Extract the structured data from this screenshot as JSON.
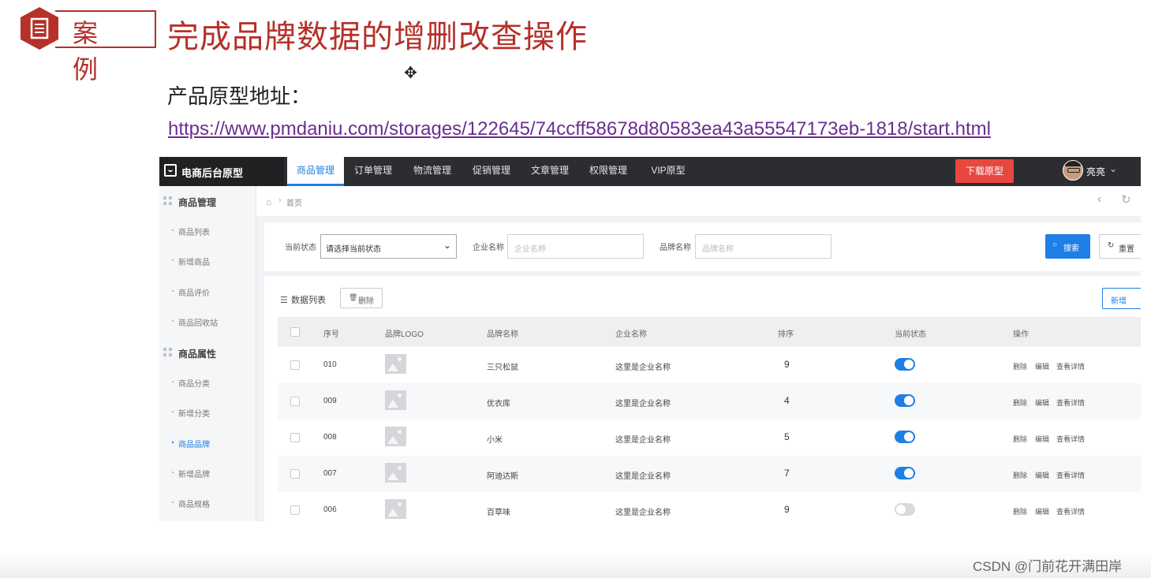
{
  "slide": {
    "badge": "案例",
    "title": "完成品牌数据的增删改查操作",
    "proto_label": "产品原型地址：",
    "proto_url": "https://www.pmdaniu.com/storages/122645/74ccff58678d80583ea43a55547173eb-1818/start.html"
  },
  "app": {
    "brand": "电商后台原型",
    "nav": [
      "商品管理",
      "订单管理",
      "物流管理",
      "促销管理",
      "文章管理",
      "权限管理",
      "VIP原型"
    ],
    "download_button": "下载原型",
    "user_name": "亮亮"
  },
  "sidebar": {
    "group1": "商品管理",
    "group1_items": [
      "商品列表",
      "新增商品",
      "商品评价",
      "商品回收站"
    ],
    "group2": "商品属性",
    "group2_items": [
      "商品分类",
      "新增分类",
      "商品品牌",
      "新增品牌",
      "商品规格"
    ],
    "active_item": "商品品牌"
  },
  "breadcrumb": {
    "current": "首页"
  },
  "filter": {
    "status_label": "当前状态",
    "status_value": "请选择当前状态",
    "company_label": "企业名称",
    "company_placeholder": "企业名称",
    "brand_label": "品牌名称",
    "brand_placeholder": "品牌名称",
    "search_button": "搜索",
    "reset_button": "重置"
  },
  "list": {
    "title": "数据列表",
    "delete_button": "删除",
    "add_button": "新增",
    "columns": [
      "序号",
      "品牌LOGO",
      "品牌名称",
      "企业名称",
      "排序",
      "当前状态",
      "操作"
    ],
    "actions": [
      "删除",
      "编辑",
      "查看详情"
    ],
    "rows": [
      {
        "id": "010",
        "brand": "三只松鼠",
        "company": "这里是企业名称",
        "order": "9",
        "enabled": true
      },
      {
        "id": "009",
        "brand": "优衣库",
        "company": "这里是企业名称",
        "order": "4",
        "enabled": true
      },
      {
        "id": "008",
        "brand": "小米",
        "company": "这里是企业名称",
        "order": "5",
        "enabled": true
      },
      {
        "id": "007",
        "brand": "阿迪达斯",
        "company": "这里是企业名称",
        "order": "7",
        "enabled": true
      },
      {
        "id": "006",
        "brand": "百草味",
        "company": "这里是企业名称",
        "order": "9",
        "enabled": false
      }
    ]
  },
  "watermark": "CSDN @门前花开满田岸",
  "colors": {
    "accent": "#1e7fe6",
    "danger": "#e8473e",
    "slide_red": "#b5312a",
    "link_purple": "#6b2e8f"
  }
}
